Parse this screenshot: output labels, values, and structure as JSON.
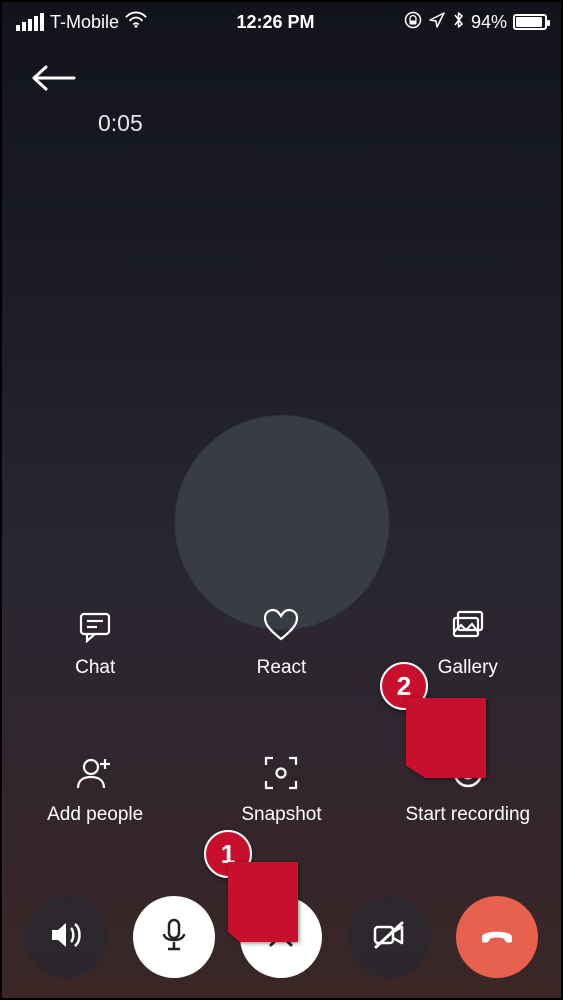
{
  "status": {
    "carrier": "T-Mobile",
    "time": "12:26 PM",
    "battery_pct": "94%"
  },
  "call": {
    "duration": "0:05"
  },
  "actions": {
    "chat": "Chat",
    "react": "React",
    "gallery": "Gallery",
    "add_people": "Add people",
    "snapshot": "Snapshot",
    "start_recording": "Start recording"
  },
  "annotations": {
    "step1": "1",
    "step2": "2"
  },
  "colors": {
    "annotation_red": "#c8102e",
    "hangup_red": "#e8614e"
  }
}
